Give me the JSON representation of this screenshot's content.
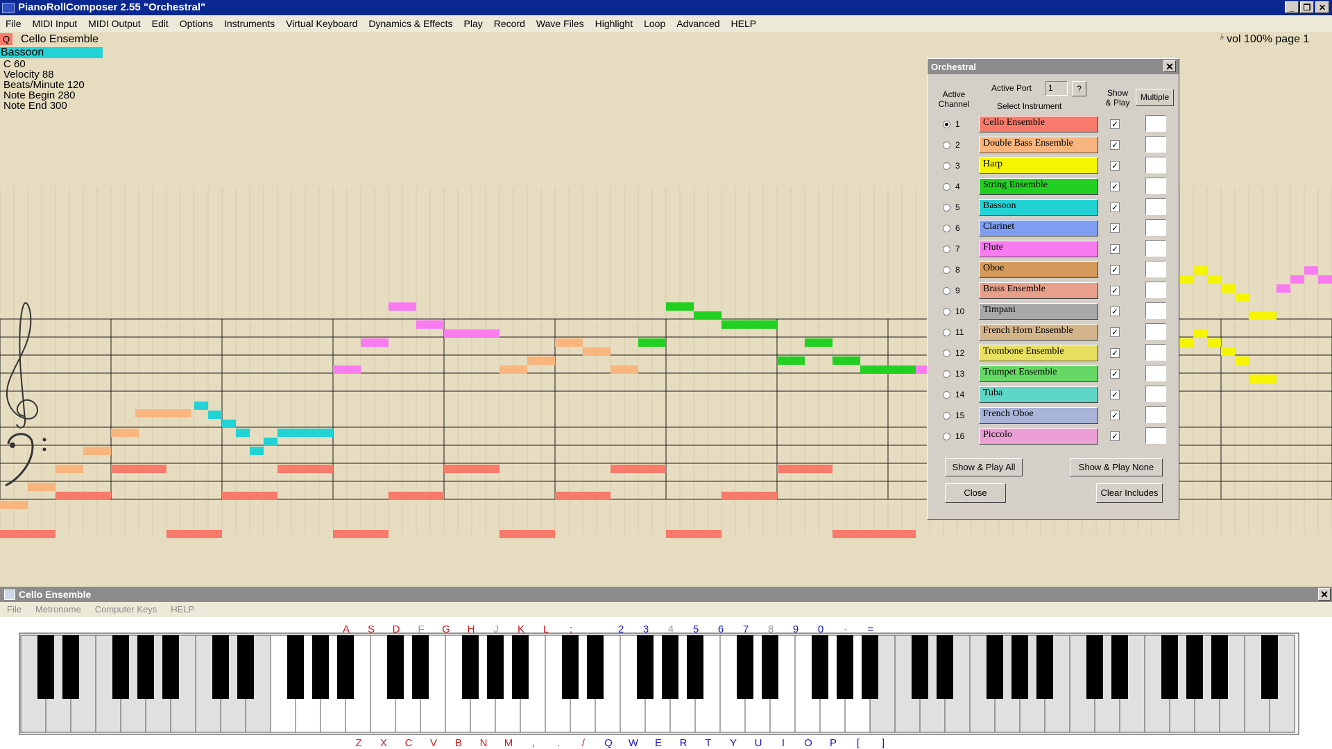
{
  "window": {
    "title": "PianoRollComposer 2.55  \"Orchestral\"",
    "buttons": [
      "_",
      "❐",
      "✕"
    ]
  },
  "menu": [
    "File",
    "MIDI Input",
    "MIDI Output",
    "Edit",
    "Options",
    "Instruments",
    "Virtual Keyboard",
    "Dynamics & Effects",
    "Play",
    "Record",
    "Wave Files",
    "Highlight",
    "Loop",
    "Advanced",
    "HELP"
  ],
  "status": {
    "q_label": "Q",
    "current_instrument": "Cello Ensemble",
    "highlight_instrument": "Bassoon",
    "highlight_color": "#22d3d6",
    "note": "C  60",
    "velocity": "Velocity 88",
    "bpm": "Beats/Minute 120",
    "note_begin": "Note Begin 280",
    "note_end": "Note End 300",
    "flat": "♭",
    "vol_page": "vol 100%  page 1"
  },
  "dialog": {
    "title": "Orchestral",
    "close": "✕",
    "active_channel_label": "Active\nChannel",
    "active_port_label": "Active Port",
    "active_port_value": "1",
    "port_help": "?",
    "select_instrument_label": "Select Instrument",
    "show_play_label": "Show\n& Play",
    "multiple_label": "Multiple",
    "check_mark": "✓",
    "channels": [
      {
        "num": "1",
        "name": "Cello Ensemble",
        "color": "#f87a6a",
        "active": true
      },
      {
        "num": "2",
        "name": "Double Bass Ensemble",
        "color": "#f8b57e",
        "active": false
      },
      {
        "num": "3",
        "name": "Harp",
        "color": "#f5f500",
        "active": false
      },
      {
        "num": "4",
        "name": "String Ensemble",
        "color": "#22d022",
        "active": false
      },
      {
        "num": "5",
        "name": "Bassoon",
        "color": "#22d3d6",
        "active": false
      },
      {
        "num": "6",
        "name": "Clarinet",
        "color": "#7f9ef0",
        "active": false
      },
      {
        "num": "7",
        "name": "Flute",
        "color": "#f87cf0",
        "active": false
      },
      {
        "num": "8",
        "name": "Oboe",
        "color": "#d49a5a",
        "active": false
      },
      {
        "num": "9",
        "name": "Brass Ensemble",
        "color": "#e8a08a",
        "active": false
      },
      {
        "num": "10",
        "name": "Timpani",
        "color": "#a8a8a8",
        "active": false
      },
      {
        "num": "11",
        "name": "French Horn Ensemble",
        "color": "#d4b48a",
        "active": false
      },
      {
        "num": "12",
        "name": "Trombone Ensemble",
        "color": "#e8e060",
        "active": false
      },
      {
        "num": "13",
        "name": "Trumpet Ensemble",
        "color": "#66d866",
        "active": false
      },
      {
        "num": "14",
        "name": "Tuba",
        "color": "#5ed6c6",
        "active": false
      },
      {
        "num": "15",
        "name": "French Oboe",
        "color": "#a8b4d8",
        "active": false
      },
      {
        "num": "16",
        "name": "Piccolo",
        "color": "#eaa0d4",
        "active": false
      }
    ],
    "show_play_all": "Show & Play All",
    "show_play_none": "Show & Play None",
    "close_button": "Close",
    "clear_includes": "Clear Includes"
  },
  "keyboard": {
    "title": "Cello Ensemble",
    "close": "✕",
    "menu": [
      "File",
      "Metronome",
      "Computer Keys",
      "HELP"
    ],
    "top_keys": [
      {
        "t": "A",
        "c": "#d01818"
      },
      {
        "t": "S",
        "c": "#d01818"
      },
      {
        "t": "D",
        "c": "#d01818"
      },
      {
        "t": "F",
        "c": "#9a9a9a"
      },
      {
        "t": "G",
        "c": "#d01818"
      },
      {
        "t": "H",
        "c": "#d01818"
      },
      {
        "t": "J",
        "c": "#9a9a9a"
      },
      {
        "t": "K",
        "c": "#d01818"
      },
      {
        "t": "L",
        "c": "#d01818"
      },
      {
        "t": ";",
        "c": "#d01818"
      },
      {
        "t": "2",
        "c": "#1818c8"
      },
      {
        "t": "3",
        "c": "#1818c8"
      },
      {
        "t": "4",
        "c": "#9a9a9a"
      },
      {
        "t": "5",
        "c": "#1818c8"
      },
      {
        "t": "6",
        "c": "#1818c8"
      },
      {
        "t": "7",
        "c": "#1818c8"
      },
      {
        "t": "8",
        "c": "#9a9a9a"
      },
      {
        "t": "9",
        "c": "#1818c8"
      },
      {
        "t": "0",
        "c": "#1818c8"
      },
      {
        "t": "-",
        "c": "#9a9a9a"
      },
      {
        "t": "=",
        "c": "#1818c8"
      }
    ],
    "bottom_keys": [
      {
        "t": "Z",
        "c": "#d01818"
      },
      {
        "t": "X",
        "c": "#d01818"
      },
      {
        "t": "C",
        "c": "#d01818"
      },
      {
        "t": "V",
        "c": "#d01818"
      },
      {
        "t": "B",
        "c": "#d01818"
      },
      {
        "t": "N",
        "c": "#d01818"
      },
      {
        "t": "M",
        "c": "#d01818"
      },
      {
        "t": ",",
        "c": "#d01818"
      },
      {
        "t": ".",
        "c": "#d01818"
      },
      {
        "t": "/",
        "c": "#d01818"
      },
      {
        "t": "Q",
        "c": "#1818c8"
      },
      {
        "t": "W",
        "c": "#1818c8"
      },
      {
        "t": "E",
        "c": "#1818c8"
      },
      {
        "t": "R",
        "c": "#1818c8"
      },
      {
        "t": "T",
        "c": "#1818c8"
      },
      {
        "t": "Y",
        "c": "#1818c8"
      },
      {
        "t": "U",
        "c": "#1818c8"
      },
      {
        "t": "I",
        "c": "#1818c8"
      },
      {
        "t": "O",
        "c": "#1818c8"
      },
      {
        "t": "P",
        "c": "#1818c8"
      },
      {
        "t": "[",
        "c": "#1818c8"
      },
      {
        "t": "]",
        "c": "#1818c8"
      }
    ]
  }
}
